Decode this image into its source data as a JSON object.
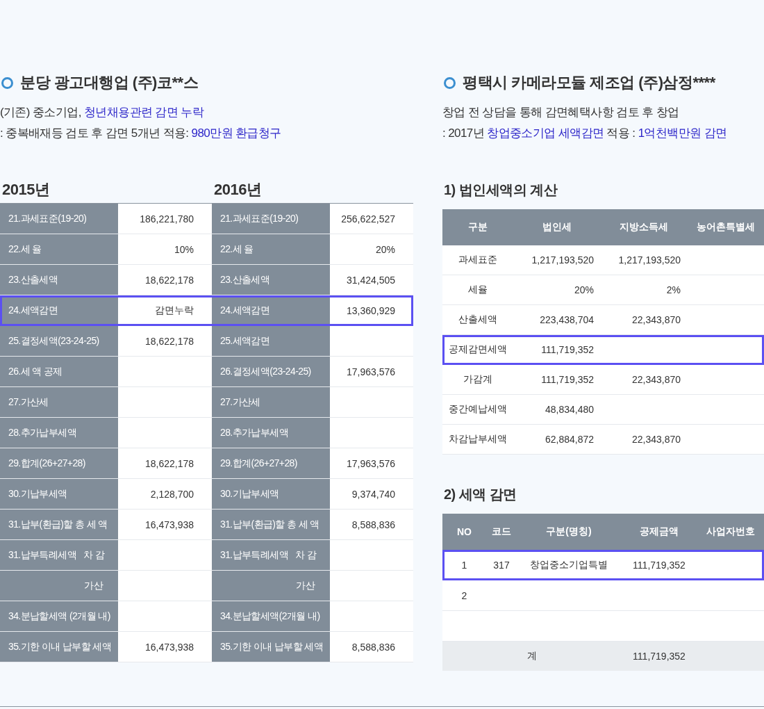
{
  "left": {
    "heading": "분당 광고대행업 (주)코**스",
    "description": [
      [
        {
          "text": "(기존) 중소기업, ",
          "emphasis": false
        },
        {
          "text": "청년채용관련 감면 누락",
          "emphasis": true
        }
      ],
      [
        {
          "text": ": 중복배재등 검토 후 감면 5개년 적용: ",
          "emphasis": false
        },
        {
          "text": "980만원 환급청구",
          "emphasis": true
        }
      ]
    ],
    "years": [
      "2015년",
      "2016년"
    ],
    "rows": [
      {
        "kind": "item",
        "label_2015": "21.과세표준(19-20)",
        "value_2015": "186,221,780",
        "label_2016": "21.과세표준(19-20)",
        "value_2016": "256,622,527",
        "highlighted": false
      },
      {
        "kind": "item",
        "label_2015": "22.세 율",
        "value_2015": "10%",
        "label_2016": "22.세 율",
        "value_2016": "20%",
        "highlighted": false
      },
      {
        "kind": "item",
        "label_2015": "23.산출세액",
        "value_2015": "18,622,178",
        "label_2016": "23.산출세액",
        "value_2016": "31,424,505",
        "highlighted": false
      },
      {
        "kind": "item",
        "label_2015": "24.세액감면",
        "value_2015": "감면누락",
        "label_2016": "24.세액감면",
        "value_2016": "13,360,929",
        "highlighted": true
      },
      {
        "kind": "item",
        "label_2015": "25.결정세액(23-24-25)",
        "value_2015": "18,622,178",
        "label_2016": "25.세액감면",
        "highlighted": false
      },
      {
        "kind": "item",
        "label_2015": "26.세 액 공제",
        "label_2016": "26.결정세액(23-24-25)",
        "value_2016": "17,963,576",
        "highlighted": false
      },
      {
        "kind": "item",
        "label_2015": "27.가산세",
        "label_2016": "27.가산세",
        "highlighted": false
      },
      {
        "kind": "item",
        "label_2015": "28.추가납부세액",
        "label_2016": "28.추가납부세액",
        "highlighted": false
      },
      {
        "kind": "item",
        "label_2015": "29.합계(26+27+28)",
        "value_2015": "18,622,178",
        "label_2016": "29.합계(26+27+28)",
        "value_2016": "17,963,576",
        "highlighted": false
      },
      {
        "kind": "item",
        "label_2015": "30.기납부세액",
        "value_2015": "2,128,700",
        "label_2016": "30.기납부세액",
        "value_2016": "9,374,740",
        "highlighted": false
      },
      {
        "kind": "item",
        "label_2015": "31.납부(환급)할 총 세 액",
        "value_2015": "16,473,938",
        "label_2016": "31.납부(환급)할 총 세 액",
        "value_2016": "8,588,836",
        "highlighted": false
      },
      {
        "kind": "item",
        "label_2015": "31.납부특례세액   차 감",
        "label_2016": "31.납부특례세액   차 감",
        "highlighted": false
      },
      {
        "kind": "sub",
        "label_2015": "가산",
        "label_2016": "가산",
        "highlighted": false
      },
      {
        "kind": "item",
        "label_2015": "34.분납할세액 (2개월 내)",
        "label_2016": "34.분납할세액(2개월 내)",
        "highlighted": false
      },
      {
        "kind": "item",
        "label_2015": "35.기한 이내 납부할 세액",
        "value_2015": "16,473,938",
        "label_2016": "35.기한 이내 납부할 세액",
        "value_2016": "8,588,836",
        "highlighted": false
      }
    ]
  },
  "right": {
    "heading": "평택시 카메라모듈 제조업 (주)삼정****",
    "description": [
      [
        {
          "text": "창업 전 상담을 통해 감면혜택사항 검토 후 창업",
          "emphasis": false
        }
      ],
      [
        {
          "text": ": 2017년 ",
          "emphasis": false
        },
        {
          "text": "창업중소기업 세액감면",
          "emphasis": true
        },
        {
          "text": " 적용 : ",
          "emphasis": false
        },
        {
          "text": "1억천백만원 감면",
          "emphasis": true
        }
      ]
    ],
    "calc": {
      "title": "1) 법인세액의 계산",
      "columns": [
        "구분",
        "법인세",
        "지방소득세",
        "농어촌특별세"
      ],
      "rows": [
        {
          "label": "과세표준",
          "corporate_tax": "1,217,193,520",
          "local_tax": "1,217,193,520",
          "highlighted": false
        },
        {
          "label": "세율",
          "corporate_tax": "20%",
          "local_tax": "2%",
          "highlighted": false
        },
        {
          "label": "산출세액",
          "corporate_tax": "223,438,704",
          "local_tax": "22,343,870",
          "highlighted": false
        },
        {
          "label": "공제감면세액",
          "corporate_tax": "111,719,352",
          "highlighted": true
        },
        {
          "label": "가감계",
          "corporate_tax": "111,719,352",
          "local_tax": "22,343,870",
          "highlighted": false
        },
        {
          "label": "중간예납세액",
          "corporate_tax": "48,834,480",
          "highlighted": false
        },
        {
          "label": "차감납부세액",
          "corporate_tax": "62,884,872",
          "local_tax": "22,343,870",
          "highlighted": false
        }
      ]
    },
    "reduction": {
      "title": "2) 세액 감면",
      "columns": [
        "NO",
        "코드",
        "구분(명칭)",
        "공제금액",
        "사업자번호"
      ],
      "rows": [
        {
          "no": "1",
          "code": "317",
          "name": "창업중소기업특별",
          "amount": "111,719,352",
          "highlighted": true
        },
        {
          "no": "2",
          "highlighted": false
        },
        {
          "highlighted": false
        }
      ],
      "total": {
        "label": "계",
        "amount": "111,719,352"
      }
    }
  }
}
